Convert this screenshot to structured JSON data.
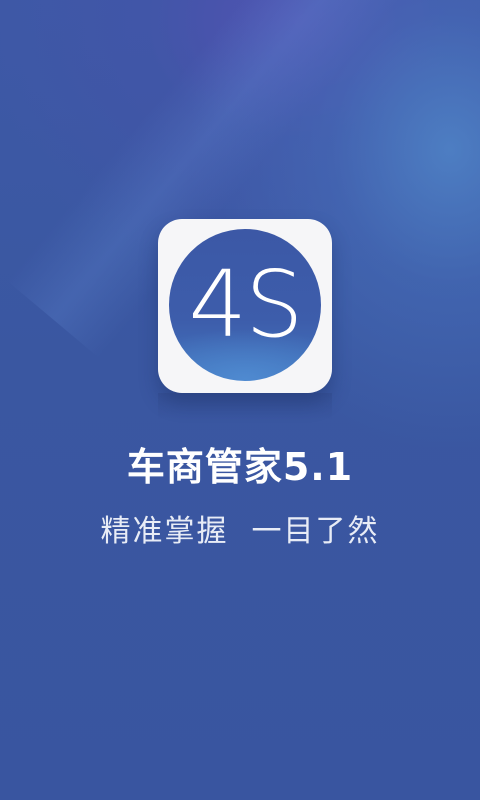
{
  "splash": {
    "logo": {
      "text": "4S",
      "icon": "4s-logo-icon"
    },
    "app_title": "车商管家5.1",
    "slogan": "精准掌握  一目了然"
  },
  "colors": {
    "background": "#3a56a0",
    "logo_tile": "#f6f6f8",
    "logo_circle": "#3c58a6",
    "text": "#ffffff"
  }
}
